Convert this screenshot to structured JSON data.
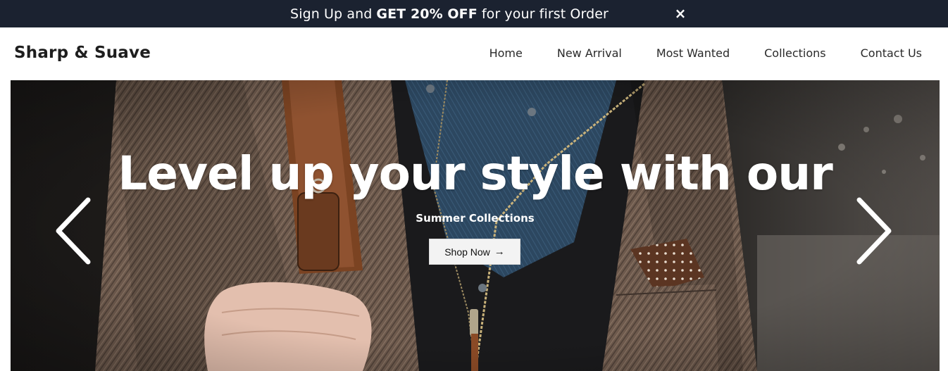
{
  "promo": {
    "text_before": "Sign Up and",
    "highlight": "GET 20% OFF",
    "text_after": "for your first Order",
    "close_icon": "×"
  },
  "header": {
    "brand": "Sharp & Suave",
    "nav": [
      "Home",
      "New Arrival",
      "Most Wanted",
      "Collections",
      "Contact Us"
    ]
  },
  "hero": {
    "title": "Level up your style with our",
    "subtitle": "Summer Collections",
    "cta_label": "Shop Now",
    "cta_icon": "→",
    "prev_icon": "chevron-left-icon",
    "next_icon": "chevron-right-icon"
  },
  "colors": {
    "promo_bg": "#1b2230",
    "text_dark": "#1e1e1e",
    "button_bg": "#f3f3f3"
  }
}
